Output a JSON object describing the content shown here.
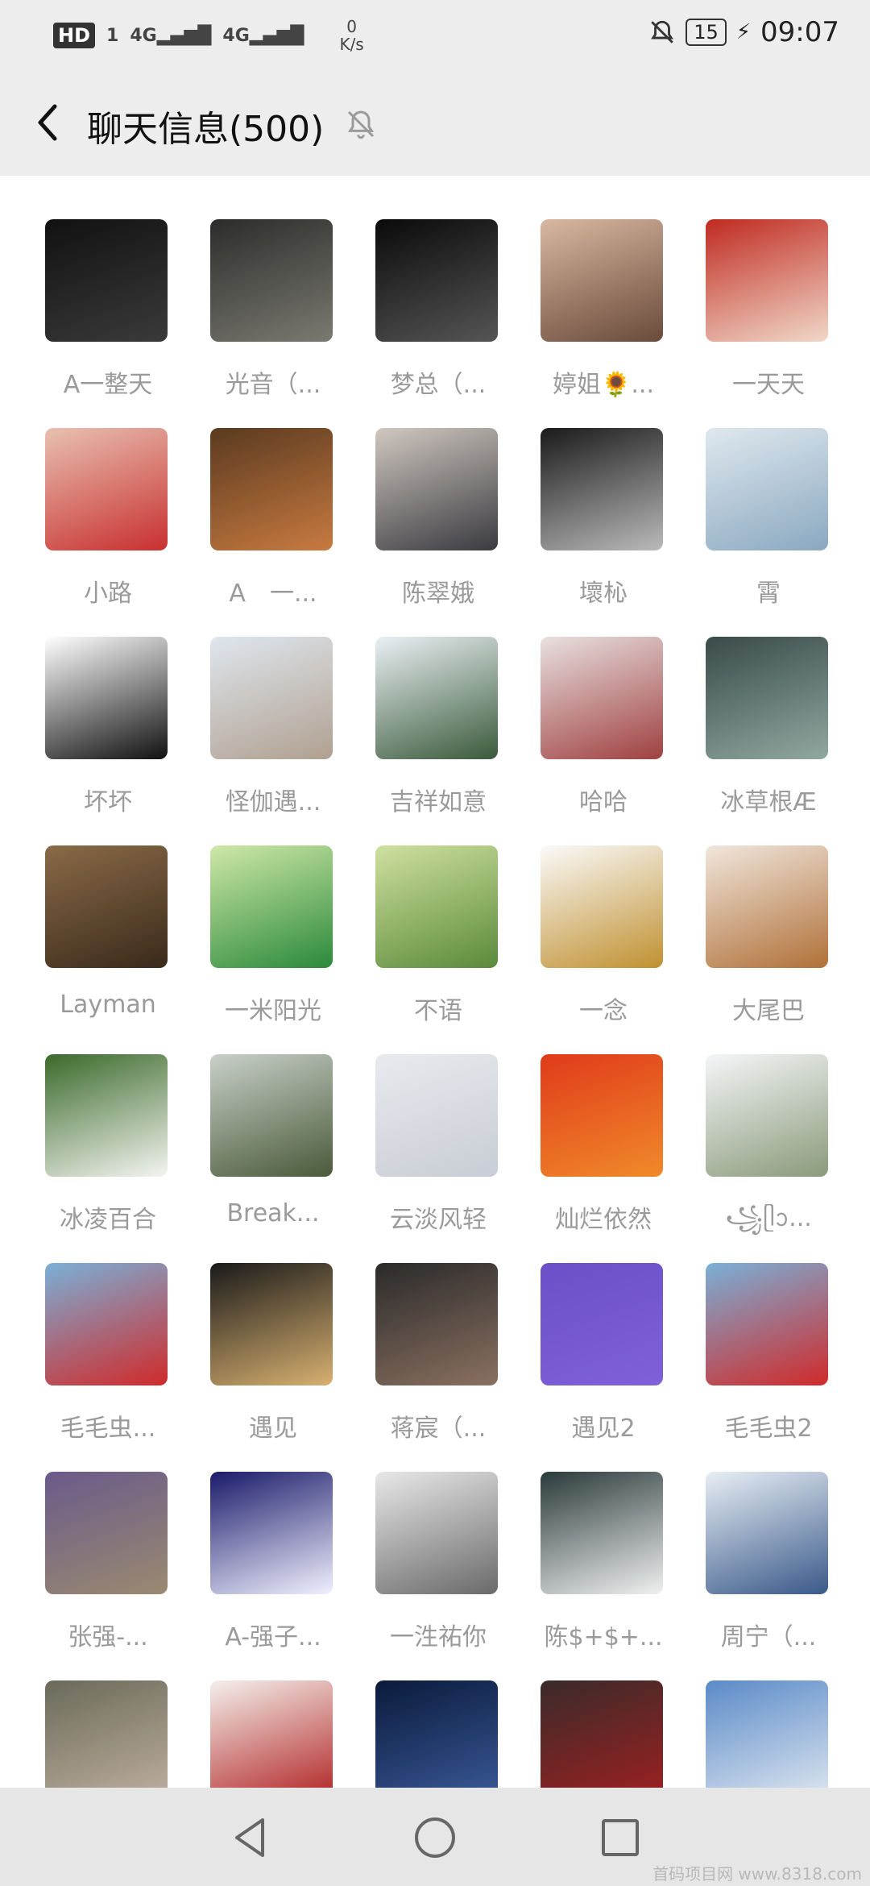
{
  "status_bar": {
    "hd": "HD",
    "sim1": "1",
    "signal1": "4G",
    "signal2": "4G",
    "speed_value": "0",
    "speed_unit": "K/s",
    "battery": "15",
    "time": "09:07"
  },
  "header": {
    "title": "聊天信息(500)"
  },
  "members": [
    {
      "name": "A一整天",
      "c1": "#111111",
      "c2": "#3a3a3a"
    },
    {
      "name": "光音（...",
      "c1": "#2c2c2c",
      "c2": "#7a7a70"
    },
    {
      "name": "梦总（...",
      "c1": "#0a0a0a",
      "c2": "#555555"
    },
    {
      "name": "婷姐🌻...",
      "c1": "#d8b8a0",
      "c2": "#6a4a3a"
    },
    {
      "name": "一天天",
      "c1": "#c02a20",
      "c2": "#f0d8c8"
    },
    {
      "name": "小路",
      "c1": "#e8c0b0",
      "c2": "#c83030"
    },
    {
      "name": "A　一...",
      "c1": "#5a3a20",
      "c2": "#c87a40"
    },
    {
      "name": "陈翠娥",
      "c1": "#d0c8c0",
      "c2": "#3a3a40"
    },
    {
      "name": "壞杺",
      "c1": "#1a1a1a",
      "c2": "#bababa"
    },
    {
      "name": "霄",
      "c1": "#dfe8ee",
      "c2": "#8aa8c0"
    },
    {
      "name": "坏坏",
      "c1": "#ffffff",
      "c2": "#111111"
    },
    {
      "name": "怪伽遇...",
      "c1": "#dfe6ee",
      "c2": "#b0a090"
    },
    {
      "name": "吉祥如意",
      "c1": "#eaf0f4",
      "c2": "#3a5a3a"
    },
    {
      "name": "哈哈",
      "c1": "#e8e0e0",
      "c2": "#a04040"
    },
    {
      "name": "冰草根Æ",
      "c1": "#3a4a48",
      "c2": "#90a8a0"
    },
    {
      "name": "Layman",
      "c1": "#8a6a48",
      "c2": "#3a2a1a"
    },
    {
      "name": "一米阳光",
      "c1": "#cfe8a8",
      "c2": "#2a8a3a"
    },
    {
      "name": "不语",
      "c1": "#cfe0a0",
      "c2": "#5a8a3a"
    },
    {
      "name": "一念",
      "c1": "#fafafa",
      "c2": "#c09030"
    },
    {
      "name": "大尾巴",
      "c1": "#f0e6dc",
      "c2": "#b07038"
    },
    {
      "name": "冰凌百合",
      "c1": "#3a6a2a",
      "c2": "#f4f4f0"
    },
    {
      "name": "Break...",
      "c1": "#c8d0c8",
      "c2": "#4a5a3a"
    },
    {
      "name": "云淡风轻",
      "c1": "#e8eaee",
      "c2": "#c8ccd4"
    },
    {
      "name": "灿烂依然",
      "c1": "#e03a1a",
      "c2": "#f08a2a"
    },
    {
      "name": "꧁ᥫᩣ...",
      "c1": "#f4f6f8",
      "c2": "#8a9a7a"
    },
    {
      "name": "毛毛虫...",
      "c1": "#7ab0d8",
      "c2": "#d02a2a"
    },
    {
      "name": "遇见",
      "c1": "#1a1a1a",
      "c2": "#d8b070"
    },
    {
      "name": "蒋宸（...",
      "c1": "#2a2a2a",
      "c2": "#8a7060"
    },
    {
      "name": "遇见2",
      "c1": "#6a50c8",
      "c2": "#8060d8"
    },
    {
      "name": "毛毛虫2",
      "c1": "#7ab0d8",
      "c2": "#d02a2a"
    },
    {
      "name": "张强-...",
      "c1": "#6a5a8a",
      "c2": "#9a8a70"
    },
    {
      "name": "A-强子...",
      "c1": "#1a1a6a",
      "c2": "#f0f0ff"
    },
    {
      "name": "一泩祐你",
      "c1": "#e8e8e8",
      "c2": "#6a6a6a"
    },
    {
      "name": "陈$+$+...",
      "c1": "#2a3a3a",
      "c2": "#f0f0f0"
    },
    {
      "name": "周宁（...",
      "c1": "#e8eef4",
      "c2": "#3a5a8a"
    },
    {
      "name": "",
      "c1": "#6a6a5a",
      "c2": "#c0b0a0"
    },
    {
      "name": "",
      "c1": "#f4f0ec",
      "c2": "#b02020"
    },
    {
      "name": "",
      "c1": "#0a1a3a",
      "c2": "#3a5a9a"
    },
    {
      "name": "",
      "c1": "#3a2a2a",
      "c2": "#a02020"
    },
    {
      "name": "",
      "c1": "#5a8ac8",
      "c2": "#e0e8f0"
    }
  ],
  "watermark": "首码项目网 www.8318.com"
}
